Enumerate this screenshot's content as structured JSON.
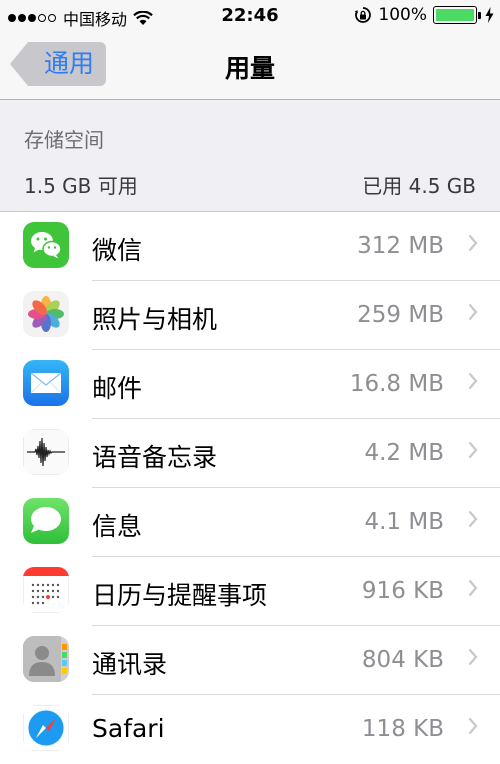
{
  "status_bar": {
    "carrier": "中国移动",
    "time": "22:46",
    "battery": "100%",
    "battery_level": 1.0,
    "signal_bars": 3,
    "signal_total": 5
  },
  "nav_bar": {
    "back_label": "通用",
    "title": "用量"
  },
  "storage": {
    "header": "存储空间",
    "available": "1.5 GB 可用",
    "used": "已用 4.5 GB"
  },
  "apps": [
    {
      "name": "微信",
      "size": "312 MB",
      "icon": "wechat-icon"
    },
    {
      "name": "照片与相机",
      "size": "259 MB",
      "icon": "photos-icon"
    },
    {
      "name": "邮件",
      "size": "16.8 MB",
      "icon": "mail-icon"
    },
    {
      "name": "语音备忘录",
      "size": "4.2 MB",
      "icon": "voice-memos-icon"
    },
    {
      "name": "信息",
      "size": "4.1 MB",
      "icon": "messages-icon"
    },
    {
      "name": "日历与提醒事项",
      "size": "916 KB",
      "icon": "calendar-icon"
    },
    {
      "name": "通讯录",
      "size": "804 KB",
      "icon": "contacts-icon"
    },
    {
      "name": "Safari",
      "size": "118 KB",
      "icon": "safari-icon"
    }
  ],
  "colors": {
    "accent": "#2e7cf6",
    "battery": "#4cd964",
    "secondary_text": "#8e8e93"
  }
}
